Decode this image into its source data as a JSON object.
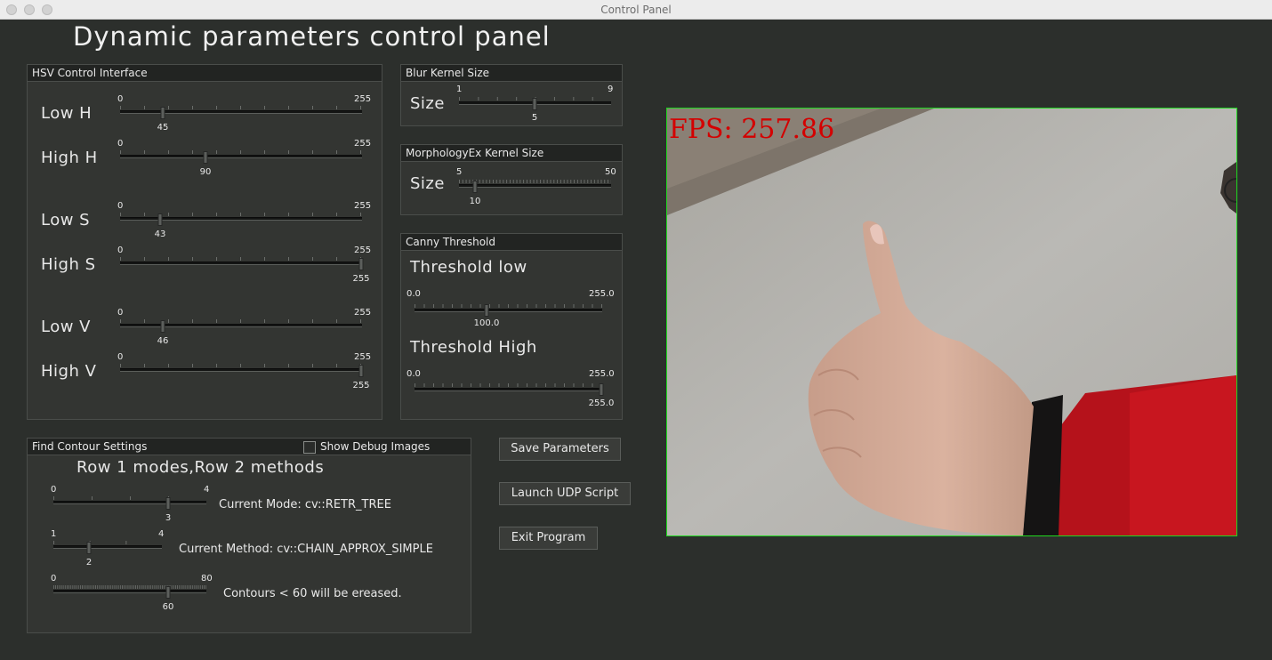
{
  "window": {
    "title": "Control Panel"
  },
  "heading": "Dynamic parameters control panel",
  "hsv": {
    "title": "HSV Control Interface",
    "sliders": [
      {
        "label": "Low   H",
        "min": "0",
        "max": "255",
        "value": "45"
      },
      {
        "label": "High  H",
        "min": "0",
        "max": "255",
        "value": "90"
      },
      {
        "label": "Low   S",
        "min": "0",
        "max": "255",
        "value": "43"
      },
      {
        "label": "High  S",
        "min": "0",
        "max": "255",
        "value": "255"
      },
      {
        "label": "Low   V",
        "min": "0",
        "max": "255",
        "value": "46"
      },
      {
        "label": "High  V",
        "min": "0",
        "max": "255",
        "value": "255"
      }
    ]
  },
  "blur": {
    "title": "Blur Kernel Size",
    "label": "Size",
    "min": "1",
    "max": "9",
    "value": "5"
  },
  "morph": {
    "title": "MorphologyEx Kernel Size",
    "label": "Size",
    "min": "5",
    "max": "50",
    "value": "10"
  },
  "canny": {
    "title": "Canny Threshold",
    "low": {
      "label": "Threshold low",
      "min": "0.0",
      "max": "255.0",
      "value": "100.0"
    },
    "high": {
      "label": "Threshold High",
      "min": "0.0",
      "max": "255.0",
      "value": "255.0"
    }
  },
  "contour": {
    "title": "Find Contour Settings",
    "debug_label": "Show Debug Images",
    "subtitle": "Row  1  modes,Row  2  methods",
    "mode": {
      "min": "0",
      "max": "4",
      "value": "3",
      "text": "Current Mode:   cv::RETR_TREE"
    },
    "method": {
      "min": "1",
      "max": "4",
      "value": "2",
      "text": "Current Method:   cv::CHAIN_APPROX_SIMPLE"
    },
    "area": {
      "min": "0",
      "max": "80",
      "value": "60",
      "text": "Contours  <  60  will  be  ereased."
    }
  },
  "buttons": {
    "save": "Save Parameters",
    "udp": "Launch UDP Script",
    "exit": "Exit Program"
  },
  "preview": {
    "fps": "FPS: 257.86",
    "border_color": "#1fd81f",
    "fps_color": "#d40000"
  }
}
